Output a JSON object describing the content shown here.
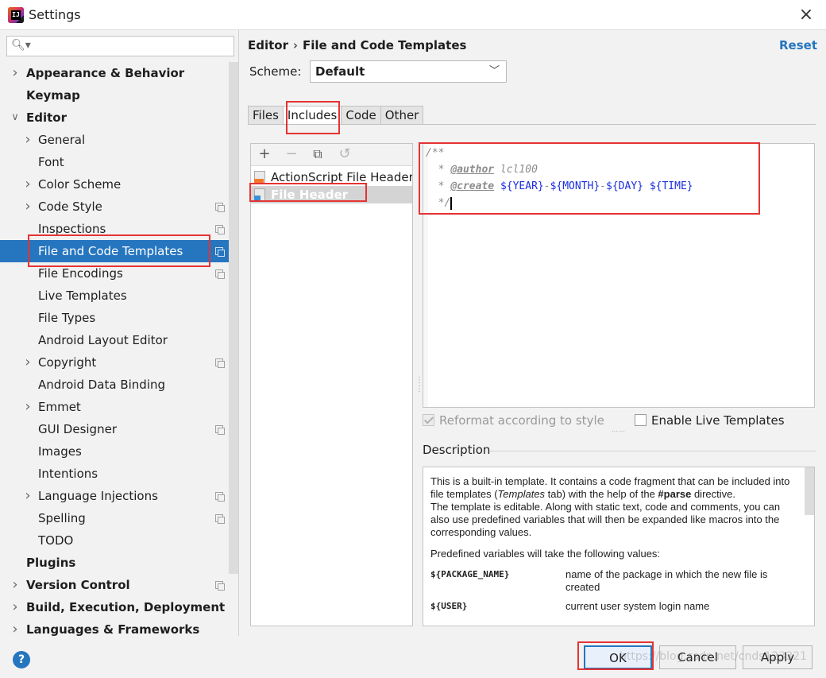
{
  "window": {
    "title": "Settings",
    "close_glyph": "×",
    "app_icon_label": "IJ"
  },
  "search": {
    "placeholder": "",
    "icon": "search-icon"
  },
  "tree": [
    {
      "label": "Appearance & Behavior",
      "level": 0,
      "bold": true,
      "arrow": "right",
      "copy": false
    },
    {
      "label": "Keymap",
      "level": 0,
      "bold": true,
      "arrow": "",
      "copy": false
    },
    {
      "label": "Editor",
      "level": 0,
      "bold": true,
      "arrow": "down",
      "copy": false
    },
    {
      "label": "General",
      "level": 1,
      "bold": false,
      "arrow": "right",
      "copy": false
    },
    {
      "label": "Font",
      "level": 1,
      "bold": false,
      "arrow": "",
      "copy": false
    },
    {
      "label": "Color Scheme",
      "level": 1,
      "bold": false,
      "arrow": "right",
      "copy": false
    },
    {
      "label": "Code Style",
      "level": 1,
      "bold": false,
      "arrow": "right",
      "copy": true
    },
    {
      "label": "Inspections",
      "level": 1,
      "bold": false,
      "arrow": "",
      "copy": true
    },
    {
      "label": "File and Code Templates",
      "level": 1,
      "bold": false,
      "arrow": "",
      "copy": true,
      "selected": true
    },
    {
      "label": "File Encodings",
      "level": 1,
      "bold": false,
      "arrow": "",
      "copy": true
    },
    {
      "label": "Live Templates",
      "level": 1,
      "bold": false,
      "arrow": "",
      "copy": false
    },
    {
      "label": "File Types",
      "level": 1,
      "bold": false,
      "arrow": "",
      "copy": false
    },
    {
      "label": "Android Layout Editor",
      "level": 1,
      "bold": false,
      "arrow": "",
      "copy": false
    },
    {
      "label": "Copyright",
      "level": 1,
      "bold": false,
      "arrow": "right",
      "copy": true
    },
    {
      "label": "Android Data Binding",
      "level": 1,
      "bold": false,
      "arrow": "",
      "copy": false
    },
    {
      "label": "Emmet",
      "level": 1,
      "bold": false,
      "arrow": "right",
      "copy": false
    },
    {
      "label": "GUI Designer",
      "level": 1,
      "bold": false,
      "arrow": "",
      "copy": true
    },
    {
      "label": "Images",
      "level": 1,
      "bold": false,
      "arrow": "",
      "copy": false
    },
    {
      "label": "Intentions",
      "level": 1,
      "bold": false,
      "arrow": "",
      "copy": false
    },
    {
      "label": "Language Injections",
      "level": 1,
      "bold": false,
      "arrow": "right",
      "copy": true
    },
    {
      "label": "Spelling",
      "level": 1,
      "bold": false,
      "arrow": "",
      "copy": true
    },
    {
      "label": "TODO",
      "level": 1,
      "bold": false,
      "arrow": "",
      "copy": false
    },
    {
      "label": "Plugins",
      "level": 0,
      "bold": true,
      "arrow": "",
      "copy": false
    },
    {
      "label": "Version Control",
      "level": 0,
      "bold": true,
      "arrow": "right",
      "copy": true
    },
    {
      "label": "Build, Execution, Deployment",
      "level": 0,
      "bold": true,
      "arrow": "right",
      "copy": false
    },
    {
      "label": "Languages & Frameworks",
      "level": 0,
      "bold": true,
      "arrow": "right",
      "copy": false
    }
  ],
  "breadcrumb": {
    "part1": "Editor",
    "sep": "›",
    "part2": "File and Code Templates"
  },
  "reset_label": "Reset",
  "scheme": {
    "label": "Scheme:",
    "value": "Default"
  },
  "tabs": [
    "Files",
    "Includes",
    "Code",
    "Other"
  ],
  "active_tab": "Includes",
  "toolbar": {
    "add": "+",
    "remove": "−",
    "copy": "⧉",
    "revert": "↺"
  },
  "templates": [
    {
      "name": "ActionScript File Header",
      "icon": "as"
    },
    {
      "name": "File Header",
      "icon": "inc",
      "selected": true
    }
  ],
  "editor": {
    "line1": "/**",
    "line2_prefix": "  * ",
    "line2_tag": "@author",
    "line2_value": " lcl100",
    "line3_prefix": "  * ",
    "line3_tag": "@create",
    "line3_vars": [
      "${YEAR}",
      "${MONTH}",
      "${DAY}",
      "${TIME}"
    ],
    "line4": "  */"
  },
  "options": {
    "reformat_label": "Reformat according to style",
    "reformat_checked": true,
    "live_label": "Enable Live Templates",
    "live_checked": false
  },
  "description": {
    "title": "Description",
    "p1_a": "This is a built-in template. It contains a code fragment that can be included into file templates (",
    "p1_em": "Templates",
    "p1_b": " tab) with the help of the ",
    "p1_strong": "#parse",
    "p1_c": " directive.",
    "p2": "The template is editable. Along with static text, code and comments, you can also use predefined variables that will then be expanded like macros into the corresponding values.",
    "p3": "Predefined variables will take the following values:",
    "vars": [
      {
        "name": "${PACKAGE_NAME}",
        "desc": "name of the package in which the new file is created"
      },
      {
        "name": "${USER}",
        "desc": "current user system login name"
      }
    ]
  },
  "buttons": {
    "ok": "OK",
    "cancel": "Cancel",
    "apply": "Apply"
  },
  "help_glyph": "?",
  "watermark": "https://blog.csdn.net/cnds123321",
  "colors": {
    "accent": "#2675bf",
    "highlight": "#e53333",
    "var": "#1a2ee0"
  }
}
